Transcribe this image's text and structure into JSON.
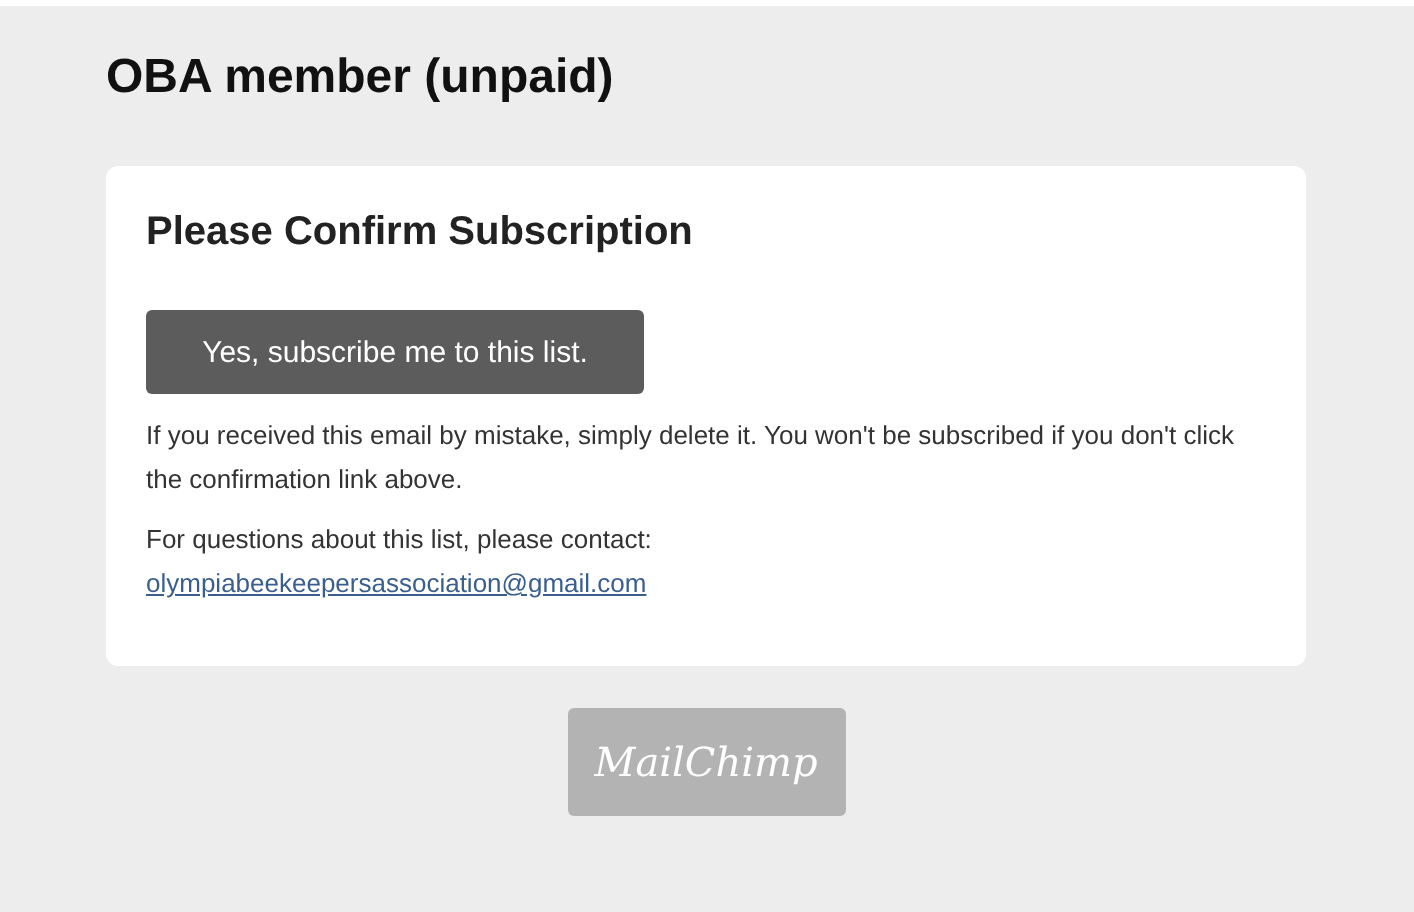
{
  "page_title": "OBA member (unpaid)",
  "card": {
    "heading": "Please Confirm Subscription",
    "button": "Yes, subscribe me to this list.",
    "notice": "If you received this email by mistake, simply delete it. You won't be subscribed if you don't click the confirmation link above.",
    "contact_label": "For questions about this list, please contact:",
    "contact_email": "olympiabeekeepersassociation@gmail.com"
  },
  "footer": {
    "logo": "MailChimp"
  }
}
